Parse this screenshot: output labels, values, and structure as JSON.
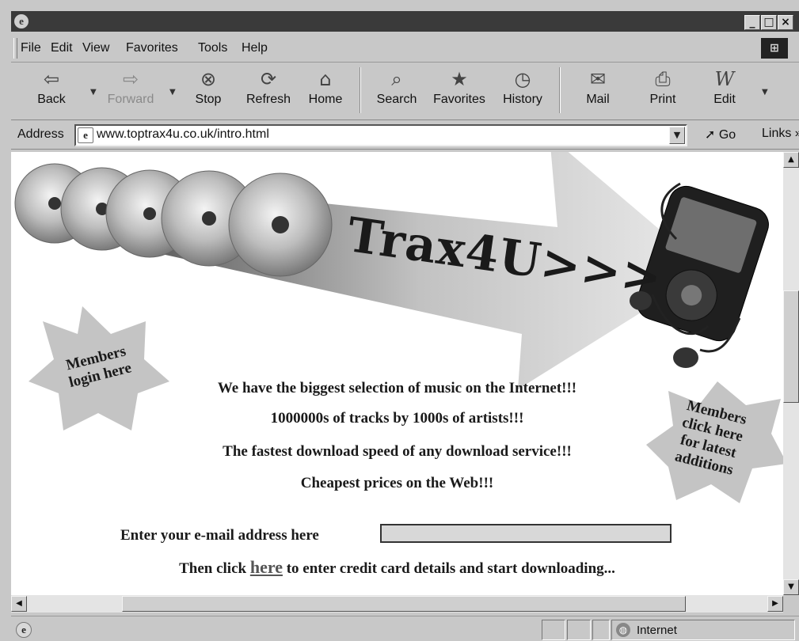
{
  "window": {
    "title": "",
    "buttons": [
      "_",
      "□",
      "×"
    ]
  },
  "menu": {
    "items": [
      "File",
      "Edit",
      "View",
      "Favorites",
      "Tools",
      "Help"
    ]
  },
  "toolbar": {
    "back": "Back",
    "forward": "Forward",
    "stop": "Stop",
    "refresh": "Refresh",
    "home": "Home",
    "search": "Search",
    "favorites": "Favorites",
    "history": "History",
    "mail": "Mail",
    "print": "Print",
    "edit": "Edit"
  },
  "address": {
    "label": "Address",
    "url": "www.toptrax4u.co.uk/intro.html",
    "go": "Go",
    "links": "Links »"
  },
  "page": {
    "brand": "Trax4U>>>",
    "login_star": "Members\nlogin here",
    "latest_star": "Members\nclick here\nfor latest\nadditions",
    "taglines": [
      "We have the biggest selection of music on the Internet!!!",
      "1000000s of tracks by 1000s of artists!!!",
      "The fastest download speed of any download service!!!",
      "Cheapest prices on the Web!!!"
    ],
    "email_label": "Enter your e-mail address here",
    "email_value": "",
    "cta_before": "Then click",
    "cta_link": "here",
    "cta_after": "to enter credit card details and start downloading..."
  },
  "status": {
    "zone": "Internet"
  }
}
